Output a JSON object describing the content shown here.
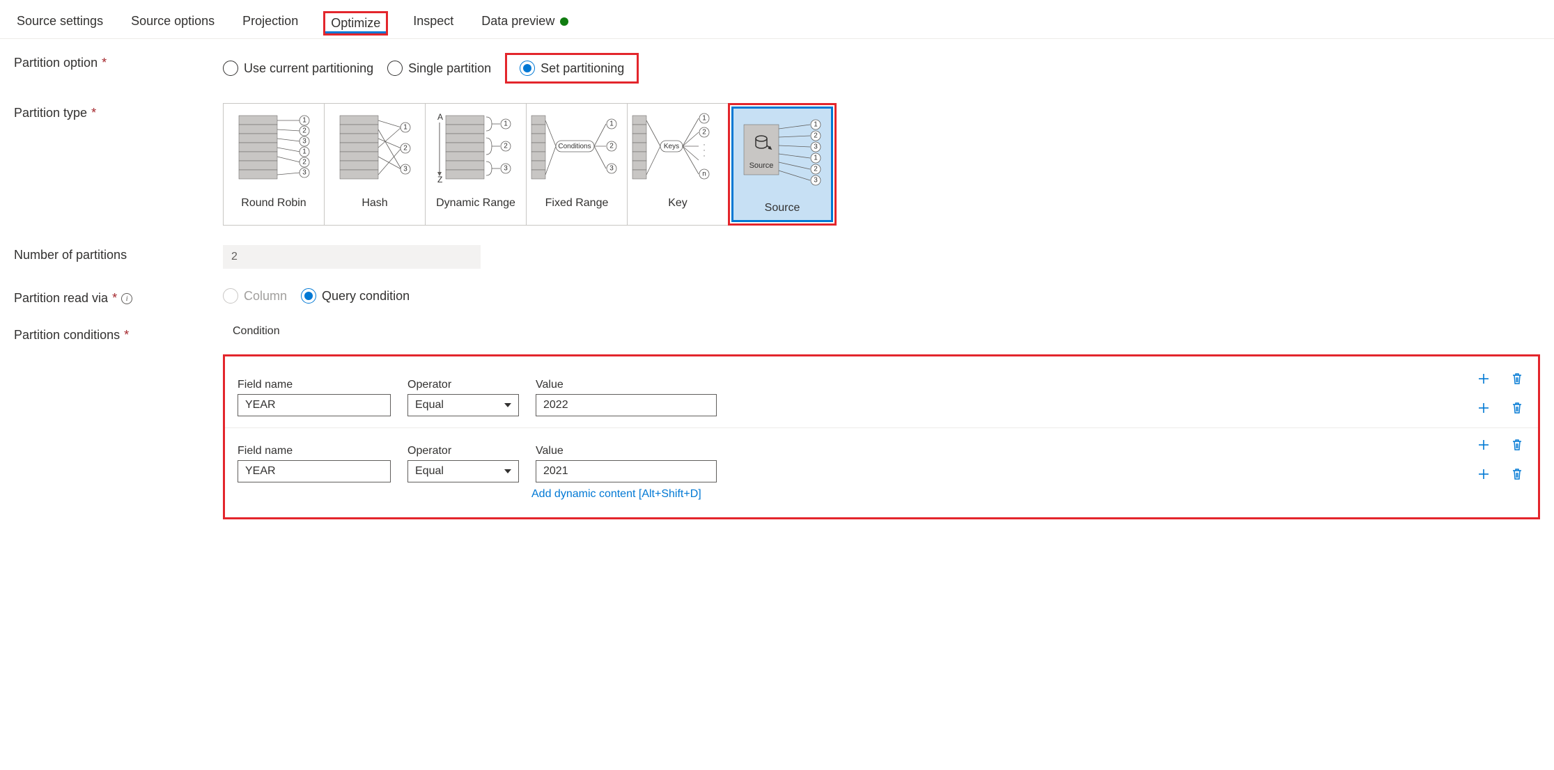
{
  "tabs": {
    "source_settings": "Source settings",
    "source_options": "Source options",
    "projection": "Projection",
    "optimize": "Optimize",
    "inspect": "Inspect",
    "data_preview": "Data preview"
  },
  "labels": {
    "partition_option": "Partition option",
    "partition_type": "Partition type",
    "number_of_partitions": "Number of partitions",
    "partition_read_via": "Partition read via",
    "partition_conditions": "Partition conditions",
    "condition": "Condition",
    "field_name": "Field name",
    "operator": "Operator",
    "value": "Value"
  },
  "partition_option": {
    "use_current": "Use current partitioning",
    "single": "Single partition",
    "set": "Set partitioning",
    "selected": "set"
  },
  "partition_types": {
    "round_robin": "Round Robin",
    "hash": "Hash",
    "dynamic_range": "Dynamic Range",
    "fixed_range": "Fixed Range",
    "key": "Key",
    "source": "Source",
    "selected": "source"
  },
  "number_of_partitions": "2",
  "partition_read_via": {
    "column": "Column",
    "query": "Query condition",
    "selected": "query"
  },
  "conditions": [
    {
      "field": "YEAR",
      "operator": "Equal",
      "value": "2022"
    },
    {
      "field": "YEAR",
      "operator": "Equal",
      "value": "2021"
    }
  ],
  "dynamic_link": "Add dynamic content [Alt+Shift+D]",
  "graphic_text": {
    "conditions": "Conditions",
    "keys": "Keys",
    "source": "Source",
    "a": "A",
    "z": "Z",
    "n": "n"
  }
}
